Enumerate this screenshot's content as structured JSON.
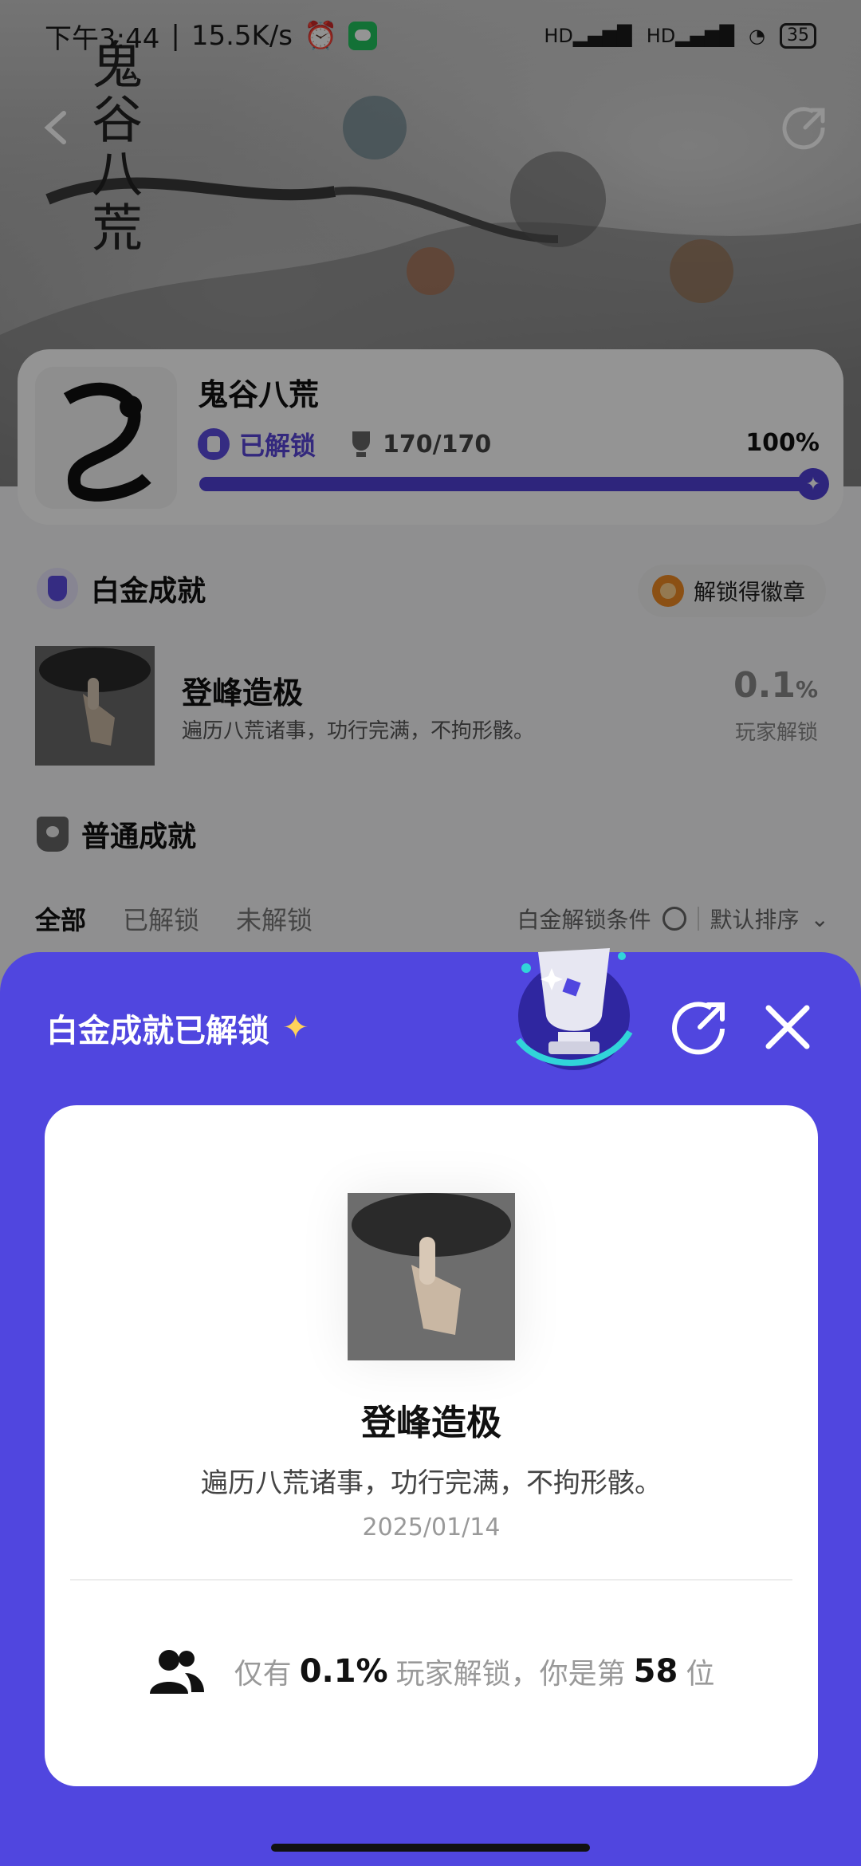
{
  "status_bar": {
    "time": "下午3:44",
    "network_speed": "15.5K/s",
    "signal_1": "HD",
    "signal_2": "HD",
    "battery": "35"
  },
  "hero": {
    "logo_text": "鬼谷八荒"
  },
  "game": {
    "title": "鬼谷八荒",
    "unlock_label": "已解锁",
    "achievement_count": "170/170",
    "percent_label": "100%",
    "progress": 1.0
  },
  "platinum": {
    "section_title": "白金成就",
    "badge_button": "解锁得徽章",
    "achievement": {
      "name": "登峰造极",
      "description": "遍历八荒诸事，功行完满，不拘形骸。",
      "rate_value": "0.1",
      "rate_unit": "%",
      "rate_label": "玩家解锁"
    }
  },
  "normal": {
    "section_title": "普通成就",
    "tabs": [
      "全部",
      "已解锁",
      "未解锁"
    ],
    "condition_label": "白金解锁条件",
    "sort_label": "默认排序"
  },
  "sheet": {
    "title": "白金成就已解锁",
    "card": {
      "name": "登峰造极",
      "description": "遍历八荒诸事，功行完满，不拘形骸。",
      "date": "2025/01/14",
      "stats_prefix": "仅有",
      "stats_rate": "0.1%",
      "stats_middle": "玩家解锁，你是第",
      "stats_rank": "58",
      "stats_suffix": "位"
    }
  },
  "colors": {
    "accent": "#5046df",
    "card": "#ffffff",
    "overlay": "rgba(0,0,0,0.42)"
  }
}
